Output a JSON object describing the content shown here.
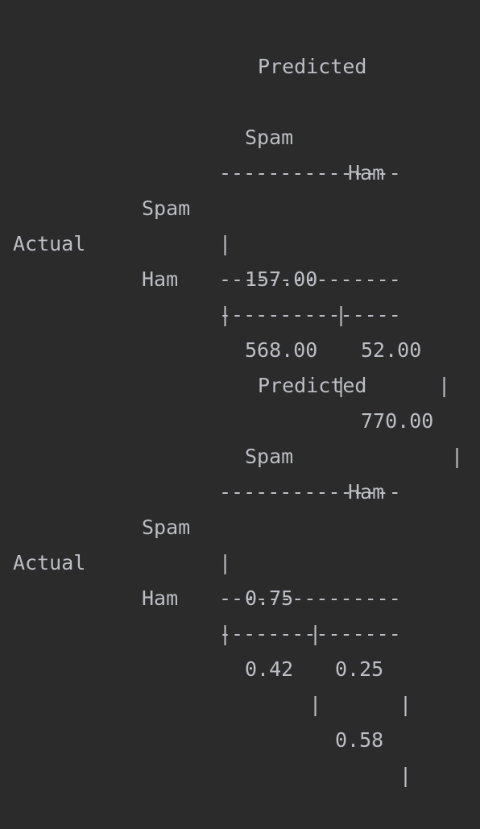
{
  "console": {
    "lines": [
      "          Predicted",
      "",
      "         Spam    Ham",
      "        ---------------",
      "     Spam  | 157.00 | 52.00 |",
      "Actual   ---------------",
      "     Ham   | 568.00 | 770.00 |",
      "        ---------------",
      "",
      "          Predicted",
      "",
      "         Spam    Ham",
      "        ---------------",
      "     Spam  | 0.75 | 0.25 |",
      "Actual   ---------------",
      "     Ham   | 0.42 | 0.58 |",
      "        ---------------"
    ]
  },
  "matrix_counts": {
    "predicted_label": "Predicted",
    "actual_label": "Actual",
    "column_headers": [
      "Spam",
      "Ham"
    ],
    "rows": [
      {
        "label": "Spam",
        "values": [
          "157.00",
          "52.00"
        ]
      },
      {
        "label": "Ham",
        "values": [
          "568.00",
          "770.00"
        ]
      }
    ]
  },
  "matrix_normalized": {
    "predicted_label": "Predicted",
    "actual_label": "Actual",
    "column_headers": [
      "Spam",
      "Ham"
    ],
    "rows": [
      {
        "label": "Spam",
        "values": [
          "0.75",
          "0.25"
        ]
      },
      {
        "label": "Ham",
        "values": [
          "0.42",
          "0.58"
        ]
      }
    ]
  }
}
